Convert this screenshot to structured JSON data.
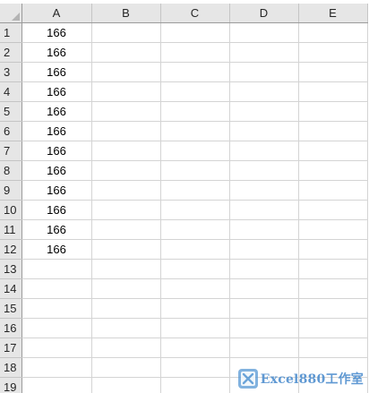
{
  "sheet": {
    "columns": [
      "A",
      "B",
      "C",
      "D",
      "E"
    ],
    "rows": [
      {
        "num": "1",
        "a": "166"
      },
      {
        "num": "2",
        "a": "166"
      },
      {
        "num": "3",
        "a": "166"
      },
      {
        "num": "4",
        "a": "166"
      },
      {
        "num": "5",
        "a": "166"
      },
      {
        "num": "6",
        "a": "166"
      },
      {
        "num": "7",
        "a": "166"
      },
      {
        "num": "8",
        "a": "166"
      },
      {
        "num": "9",
        "a": "166"
      },
      {
        "num": "10",
        "a": "166"
      },
      {
        "num": "11",
        "a": "166"
      },
      {
        "num": "12",
        "a": "166"
      },
      {
        "num": "13",
        "a": ""
      },
      {
        "num": "14",
        "a": ""
      },
      {
        "num": "15",
        "a": ""
      },
      {
        "num": "16",
        "a": ""
      },
      {
        "num": "17",
        "a": ""
      },
      {
        "num": "18",
        "a": ""
      },
      {
        "num": "19",
        "a": ""
      }
    ]
  },
  "watermark": {
    "text": "Excel880工作室",
    "logo_icon": "excel880-logo-icon",
    "color": "#4f8fcf"
  }
}
